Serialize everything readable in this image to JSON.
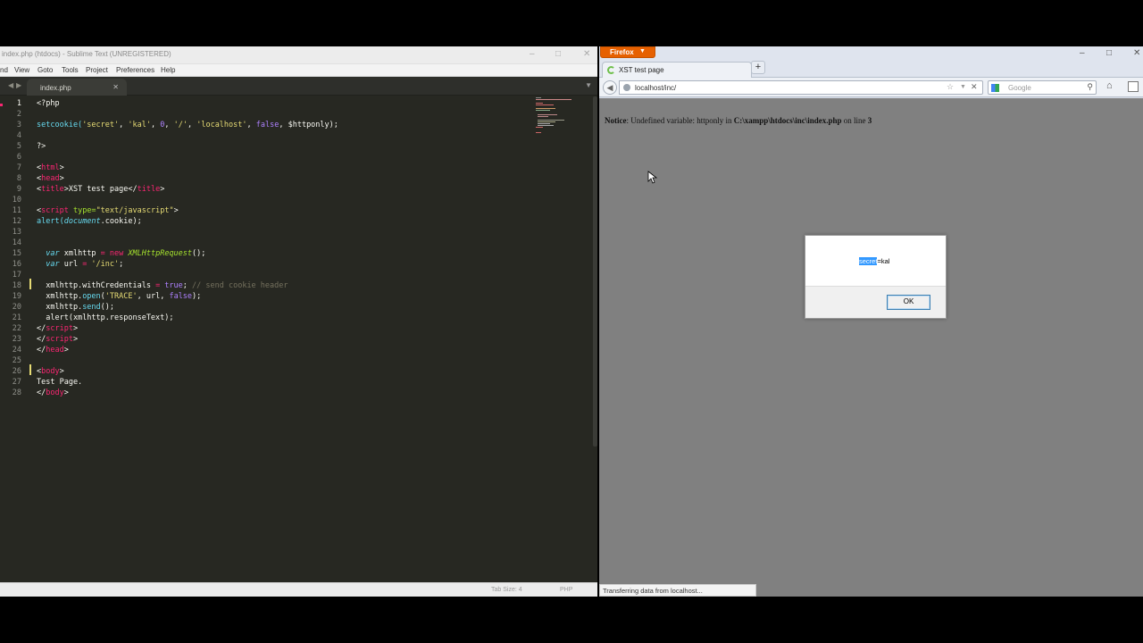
{
  "sublime": {
    "title": "index.php (htdocs) - Sublime Text (UNREGISTERED)",
    "menu": [
      "nd",
      "View",
      "Goto",
      "Tools",
      "Project",
      "Preferences",
      "Help"
    ],
    "tab_label": "index.php",
    "status": {
      "tab_size": "Tab Size: 4",
      "syntax": "PHP"
    },
    "line_numbers": [
      "1",
      "2",
      "3",
      "4",
      "5",
      "6",
      "7",
      "8",
      "9",
      "10",
      "11",
      "12",
      "13",
      "14",
      "15",
      "16",
      "17",
      "18",
      "19",
      "20",
      "21",
      "22",
      "23",
      "24",
      "25",
      "26",
      "27",
      "28"
    ],
    "code": {
      "l1": "<?php",
      "l3a": "setcookie(",
      "l3b": "'secret'",
      "l3c": ", ",
      "l3d": "'kal'",
      "l3e": ", ",
      "l3f": "0",
      "l3g": ", ",
      "l3h": "'/'",
      "l3i": ", ",
      "l3j": "'localhost'",
      "l3k": ", ",
      "l3l": "false",
      "l3m": ", $httponly);",
      "l5": "?>",
      "l7a": "<",
      "l7b": "html",
      "l7c": ">",
      "l8a": "<",
      "l8b": "head",
      "l8c": ">",
      "l9a": "<",
      "l9b": "title",
      "l9c": ">XST test page</",
      "l9d": "title",
      "l9e": ">",
      "l11a": "<",
      "l11b": "script",
      "l11c": " type=",
      "l11d": "\"text/javascript\"",
      "l11e": ">",
      "l12a": "alert(",
      "l12b": "document",
      "l12c": ".cookie);",
      "l15a": "  var",
      "l15b": " xmlhttp ",
      "l15c": "=",
      "l15d": " new",
      "l15e": " XMLHttpRequest",
      "l15f": "();",
      "l16a": "  var",
      "l16b": " url ",
      "l16c": "=",
      "l16d": " '/inc'",
      "l16e": ";",
      "l18a": "  xmlhttp.withCredentials ",
      "l18b": "=",
      "l18c": " true",
      "l18d": "; ",
      "l18e": "// send cookie header",
      "l19a": "  xmlhttp.",
      "l19b": "open",
      "l19c": "(",
      "l19d": "'TRACE'",
      "l19e": ", url, ",
      "l19f": "false",
      "l19g": ");",
      "l20a": "  xmlhttp.",
      "l20b": "send",
      "l20c": "();",
      "l21": "  alert(xmlhttp.responseText);",
      "l22a": "</",
      "l22b": "script",
      "l22c": ">",
      "l23a": "</",
      "l23b": "script",
      "l23c": ">",
      "l24a": "</",
      "l24b": "head",
      "l24c": ">",
      "l26a": "<",
      "l26b": "body",
      "l26c": ">",
      "l27": "Test Page.",
      "l28a": "</",
      "l28b": "body",
      "l28c": ">"
    }
  },
  "firefox": {
    "menu_button": "Firefox",
    "tab_title": "XST test page",
    "new_tab": "+",
    "url": "localhost/inc/",
    "search_placeholder": "Google",
    "notice": {
      "label": "Notice",
      "text": ": Undefined variable: httponly in ",
      "path": "C:\\xampp\\htdocs\\inc\\index.php",
      "line_text": " on line ",
      "line": "3"
    },
    "alert": {
      "selected": "secret",
      "rest": "=kal",
      "ok": "OK"
    },
    "status": "Transferring data from localhost..."
  },
  "colors": {
    "editor_bg": "#272822",
    "keyword": "#f92672",
    "function": "#66d9ef",
    "string": "#e6db74",
    "number": "#ae81ff",
    "comment": "#75715e",
    "firefox_orange": "#e66000",
    "selection": "#3399ff"
  }
}
